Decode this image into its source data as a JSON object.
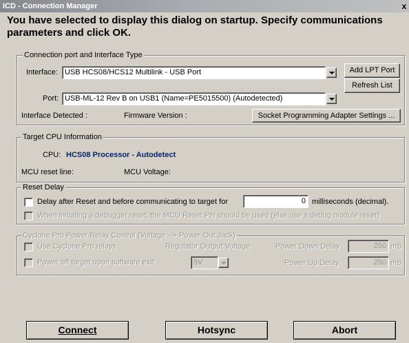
{
  "window": {
    "title": "ICD - Connection Manager",
    "close_glyph": "x"
  },
  "headline": "You have selected to display this dialog on startup. Specify communications parameters and click OK.",
  "connection": {
    "legend": "Connection port and Interface Type",
    "interface_label": "Interface:",
    "interface_value": "USB HCS08/HCS12 Multilink - USB Port",
    "port_label": "Port:",
    "port_value": "USB-ML-12 Rev B on USB1 (Name=PE5015500) (Autodetected)",
    "add_lpt_label": "Add LPT Port",
    "refresh_label": "Refresh List",
    "interface_detected_label": "Interface Detected :",
    "firmware_label": "Firmware Version :",
    "socket_button_label": "Socket Programming Adapter Settings ..."
  },
  "target_cpu": {
    "legend": "Target CPU Information",
    "cpu_label": "CPU:",
    "cpu_value": "HCS08 Processor - Autodetect",
    "mcu_reset_label": "MCU reset line:",
    "mcu_voltage_label": "MCU Voltage:"
  },
  "reset_delay": {
    "legend": "Reset Delay",
    "delay_label": "Delay after Reset and before communicating to target for",
    "delay_value": "0",
    "delay_unit": "milliseconds (decimal).",
    "debugger_reset_label": "When initiating a debugger reset, the MCU Reset Pin should be used (else use a debug module reset)"
  },
  "cyclone": {
    "legend": "Cyclone Pro Power Relay Control  (Voltage --> Power-Out Jack)",
    "use_relays_label": "Use Cyclone Pro relays",
    "regulator_label": "Regulator Output Voltage",
    "power_down_label": "Power Down Delay",
    "power_down_value": "250",
    "power_off_label": "Power off target upon software exit",
    "voltage_value": "5V",
    "power_up_label": "Power Up Delay",
    "power_up_value": "250",
    "unit_ms": "mS"
  },
  "buttons": {
    "connect": "Connect",
    "hotsync": "Hotsync",
    "abort": "Abort"
  }
}
